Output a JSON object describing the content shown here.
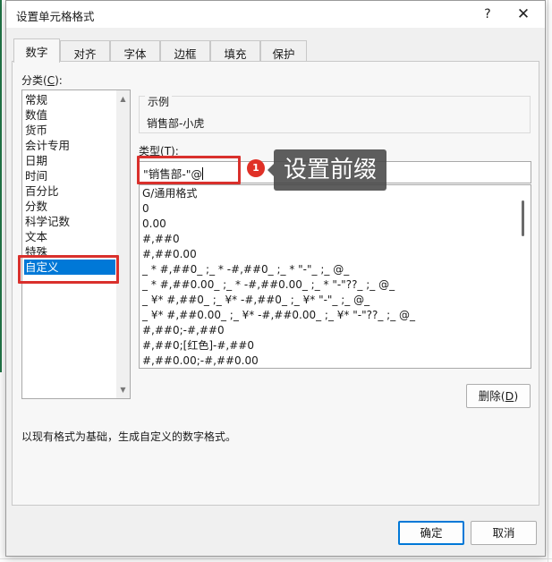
{
  "dialog": {
    "title": "设置单元格格式",
    "help_glyph": "?",
    "close_glyph": "✕"
  },
  "tabs": [
    {
      "label": "数字",
      "active": true
    },
    {
      "label": "对齐"
    },
    {
      "label": "字体"
    },
    {
      "label": "边框"
    },
    {
      "label": "填充"
    },
    {
      "label": "保护"
    }
  ],
  "category": {
    "label": "分类(",
    "label_key": "C",
    "label_end": "):",
    "items": [
      "常规",
      "数值",
      "货币",
      "会计专用",
      "日期",
      "时间",
      "百分比",
      "分数",
      "科学记数",
      "文本",
      "特殊",
      "自定义"
    ],
    "selected": "自定义"
  },
  "sample": {
    "legend": "示例",
    "value": "销售部-小虎"
  },
  "type": {
    "label": "类型(",
    "label_key": "T",
    "label_end": "):",
    "value": "\"销售部-\"@"
  },
  "formats": [
    "G/通用格式",
    "0",
    "0.00",
    "#,##0",
    "#,##0.00",
    "_ * #,##0_ ;_ * -#,##0_ ;_ * \"-\"_ ;_ @_",
    "_ * #,##0.00_ ;_ * -#,##0.00_ ;_ * \"-\"??_ ;_ @_",
    "_ ¥* #,##0_ ;_ ¥* -#,##0_ ;_ ¥* \"-\"_ ;_ @_",
    "_ ¥* #,##0.00_ ;_ ¥* -#,##0.00_ ;_ ¥* \"-\"??_ ;_ @_",
    "#,##0;-#,##0",
    "#,##0;[红色]-#,##0",
    "#,##0.00;-#,##0.00"
  ],
  "buttons": {
    "delete": "删除(",
    "delete_key": "D",
    "delete_end": ")",
    "ok": "确定",
    "cancel": "取消"
  },
  "description": "以现有格式为基础，生成自定义的数字格式。",
  "annotation": {
    "badge": "1",
    "callout": "设置前缀",
    "color": "#d9302c"
  }
}
